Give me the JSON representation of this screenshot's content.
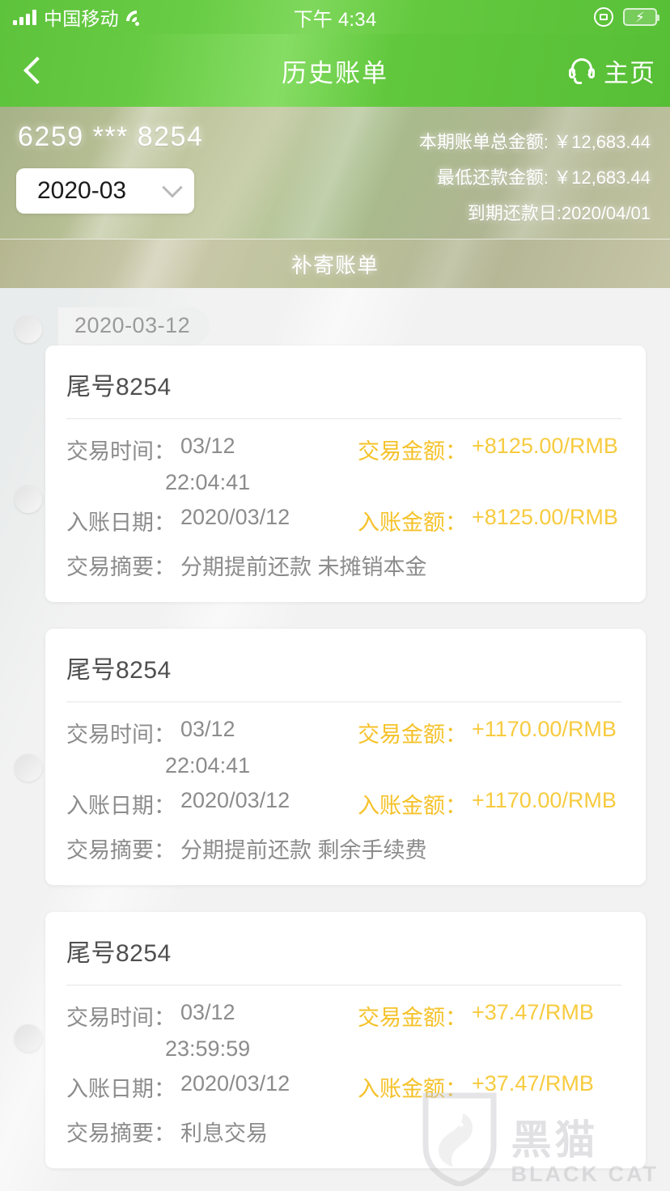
{
  "status_bar": {
    "carrier": "中国移动",
    "signal_icon": "signal-bars-icon",
    "wifi_icon": "wifi-icon",
    "time": "下午 4:34",
    "rotation_lock_icon": "rotation-lock-icon",
    "battery_icon": "battery-charging-icon",
    "battery_bolt": "⚡"
  },
  "nav_bar": {
    "back_icon": "chevron-left-icon",
    "title": "历史账单",
    "service_icon": "headset-icon",
    "home_label": "主页"
  },
  "summary": {
    "card_number": "6259 *** 8254",
    "month_selected": "2020-03",
    "month_dropdown_icon": "chevron-down-icon",
    "total_amount_line": "本期账单总金额: ￥12,683.44",
    "min_payment_line": "最低还款金额: ￥12,683.44",
    "due_date_line": "到期还款日:2020/04/01"
  },
  "resend_bar": {
    "label": "补寄账单"
  },
  "list": {
    "date_group": "2020-03-12",
    "labels": {
      "txn_time": "交易时间：",
      "post_date": "入账日期：",
      "summary": "交易摘要：",
      "txn_amount": "交易金额：",
      "post_amount": "入账金额："
    },
    "transactions": [
      {
        "card_tail": "尾号8254",
        "txn_date": "03/12",
        "txn_time": "22:04:41",
        "post_date": "2020/03/12",
        "txn_amount": "+8125.00/RMB",
        "post_amount": "+8125.00/RMB",
        "summary": "分期提前还款 未摊销本金"
      },
      {
        "card_tail": "尾号8254",
        "txn_date": "03/12",
        "txn_time": "22:04:41",
        "post_date": "2020/03/12",
        "txn_amount": "+1170.00/RMB",
        "post_amount": "+1170.00/RMB",
        "summary": "分期提前还款 剩余手续费"
      },
      {
        "card_tail": "尾号8254",
        "txn_date": "03/12",
        "txn_time": "23:59:59",
        "post_date": "2020/03/12",
        "txn_amount": "+37.47/RMB",
        "post_amount": "+37.47/RMB",
        "summary": "利息交易"
      }
    ]
  },
  "watermark": {
    "shield_icon": "black-cat-shield-icon",
    "cn": "黑猫",
    "en": "BLACK CAT"
  },
  "colors": {
    "brand_green": "#5ec33c",
    "amount_yellow": "#f5c22a",
    "label_gray": "#8c8c8c",
    "page_bg": "#f2f2f2"
  }
}
